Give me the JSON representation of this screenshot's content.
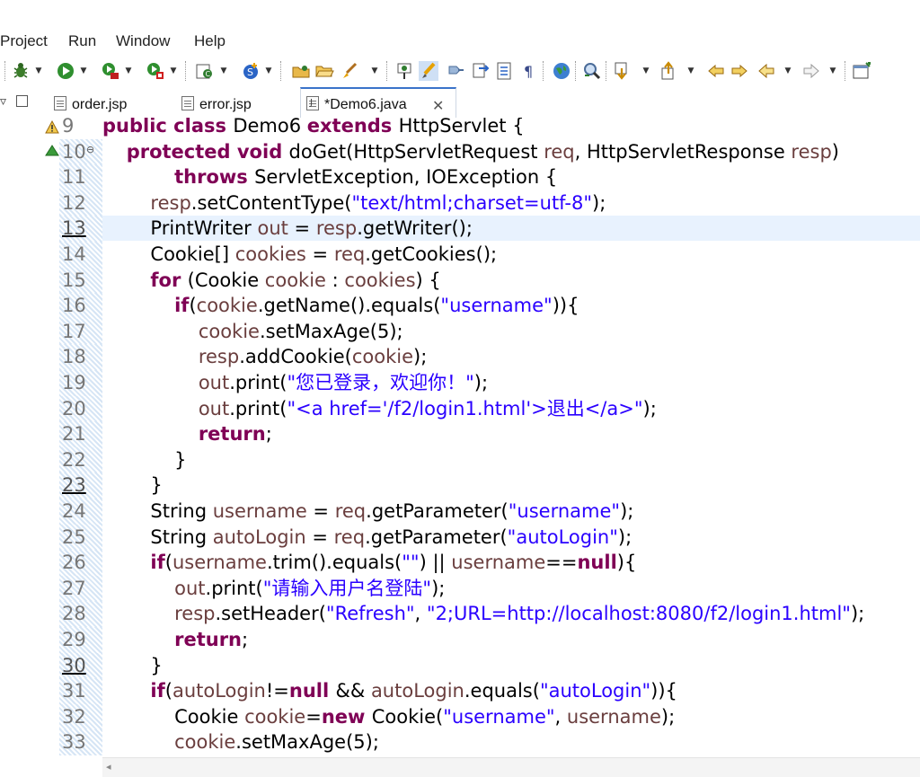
{
  "menu": [
    "Project",
    "Run",
    "Window",
    "Help"
  ],
  "tabs": [
    {
      "label": "order.jsp",
      "active": false
    },
    {
      "label": "error.jsp",
      "active": false
    },
    {
      "label": "*Demo6.java",
      "active": true
    }
  ],
  "toolbar_icons": [
    "bug-debug-icon",
    "run-icon",
    "run-server-icon",
    "external-tools-icon",
    "new-class-icon",
    "new-service-icon",
    "open-type-icon",
    "open-folder-icon",
    "brush-icon",
    "pin-icon",
    "highlighter-icon",
    "marker-icon",
    "bookmark-icon",
    "task-list-icon",
    "show-whitespace-icon",
    "globe-icon",
    "search-icon",
    "next-annotation-icon",
    "prev-annotation-icon",
    "back-icon",
    "forward-icon",
    "previous-edit-icon",
    "next-edit-icon",
    "new-window-icon"
  ],
  "editor": {
    "current_line": "13",
    "lines": [
      {
        "num": "9",
        "marked": false,
        "band": false,
        "segments": [
          {
            "t": "public class ",
            "k": "kw"
          },
          {
            "t": "Demo6 "
          },
          {
            "t": "extends ",
            "k": "kw"
          },
          {
            "t": "HttpServlet {"
          }
        ]
      },
      {
        "num": "10",
        "marked": false,
        "band": true,
        "segments": [
          {
            "t": "    "
          },
          {
            "t": "protected void ",
            "k": "kw"
          },
          {
            "t": "doGet(HttpServletRequest "
          },
          {
            "t": "req",
            "k": "fld"
          },
          {
            "t": ", HttpServletResponse "
          },
          {
            "t": "resp",
            "k": "fld"
          },
          {
            "t": ")"
          }
        ]
      },
      {
        "num": "11",
        "marked": false,
        "band": true,
        "segments": [
          {
            "t": "            "
          },
          {
            "t": "throws ",
            "k": "kw"
          },
          {
            "t": "ServletException, IOException {"
          }
        ]
      },
      {
        "num": "12",
        "marked": false,
        "band": true,
        "segments": [
          {
            "t": "        "
          },
          {
            "t": "resp",
            "k": "fld"
          },
          {
            "t": ".setContentType("
          },
          {
            "t": "\"text/html;charset=utf-8\"",
            "k": "str"
          },
          {
            "t": ");"
          }
        ]
      },
      {
        "num": "13",
        "marked": true,
        "band": true,
        "segments": [
          {
            "t": "        PrintWriter "
          },
          {
            "t": "out",
            "k": "fld"
          },
          {
            "t": " = "
          },
          {
            "t": "resp",
            "k": "fld"
          },
          {
            "t": ".getWriter();"
          }
        ]
      },
      {
        "num": "14",
        "marked": false,
        "band": true,
        "segments": [
          {
            "t": "        Cookie[] "
          },
          {
            "t": "cookies",
            "k": "fld"
          },
          {
            "t": " = "
          },
          {
            "t": "req",
            "k": "fld"
          },
          {
            "t": ".getCookies();"
          }
        ]
      },
      {
        "num": "15",
        "marked": false,
        "band": true,
        "segments": [
          {
            "t": "        "
          },
          {
            "t": "for ",
            "k": "kw"
          },
          {
            "t": "(Cookie "
          },
          {
            "t": "cookie",
            "k": "fld"
          },
          {
            "t": " : "
          },
          {
            "t": "cookies",
            "k": "fld"
          },
          {
            "t": ") {"
          }
        ]
      },
      {
        "num": "16",
        "marked": false,
        "band": true,
        "segments": [
          {
            "t": "            "
          },
          {
            "t": "if",
            "k": "kw"
          },
          {
            "t": "("
          },
          {
            "t": "cookie",
            "k": "fld"
          },
          {
            "t": ".getName().equals("
          },
          {
            "t": "\"username\"",
            "k": "str"
          },
          {
            "t": ")){"
          }
        ]
      },
      {
        "num": "17",
        "marked": false,
        "band": true,
        "segments": [
          {
            "t": "                "
          },
          {
            "t": "cookie",
            "k": "fld"
          },
          {
            "t": ".setMaxAge(5);"
          }
        ]
      },
      {
        "num": "18",
        "marked": false,
        "band": true,
        "segments": [
          {
            "t": "                "
          },
          {
            "t": "resp",
            "k": "fld"
          },
          {
            "t": ".addCookie("
          },
          {
            "t": "cookie",
            "k": "fld"
          },
          {
            "t": ");"
          }
        ]
      },
      {
        "num": "19",
        "marked": false,
        "band": true,
        "segments": [
          {
            "t": "                "
          },
          {
            "t": "out",
            "k": "fld"
          },
          {
            "t": ".print("
          },
          {
            "t": "\"您已登录，欢迎你！\"",
            "k": "str"
          },
          {
            "t": ");"
          }
        ]
      },
      {
        "num": "20",
        "marked": false,
        "band": true,
        "segments": [
          {
            "t": "                "
          },
          {
            "t": "out",
            "k": "fld"
          },
          {
            "t": ".print("
          },
          {
            "t": "\"<a href='/f2/login1.html'>退出</a>\"",
            "k": "str"
          },
          {
            "t": ");"
          }
        ]
      },
      {
        "num": "21",
        "marked": false,
        "band": true,
        "segments": [
          {
            "t": "                "
          },
          {
            "t": "return",
            "k": "kw"
          },
          {
            "t": ";"
          }
        ]
      },
      {
        "num": "22",
        "marked": false,
        "band": true,
        "segments": [
          {
            "t": "            }"
          }
        ]
      },
      {
        "num": "23",
        "marked": true,
        "band": true,
        "segments": [
          {
            "t": "        }"
          }
        ]
      },
      {
        "num": "24",
        "marked": false,
        "band": true,
        "segments": [
          {
            "t": "        String "
          },
          {
            "t": "username",
            "k": "fld"
          },
          {
            "t": " = "
          },
          {
            "t": "req",
            "k": "fld"
          },
          {
            "t": ".getParameter("
          },
          {
            "t": "\"username\"",
            "k": "str"
          },
          {
            "t": ");"
          }
        ]
      },
      {
        "num": "25",
        "marked": false,
        "band": true,
        "segments": [
          {
            "t": "        String "
          },
          {
            "t": "autoLogin",
            "k": "fld"
          },
          {
            "t": " = "
          },
          {
            "t": "req",
            "k": "fld"
          },
          {
            "t": ".getParameter("
          },
          {
            "t": "\"autoLogin\"",
            "k": "str"
          },
          {
            "t": ");"
          }
        ]
      },
      {
        "num": "26",
        "marked": false,
        "band": true,
        "segments": [
          {
            "t": "        "
          },
          {
            "t": "if",
            "k": "kw"
          },
          {
            "t": "("
          },
          {
            "t": "username",
            "k": "fld"
          },
          {
            "t": ".trim().equals("
          },
          {
            "t": "\"\"",
            "k": "str"
          },
          {
            "t": ") || "
          },
          {
            "t": "username",
            "k": "fld"
          },
          {
            "t": "=="
          },
          {
            "t": "null",
            "k": "kw"
          },
          {
            "t": "){"
          }
        ]
      },
      {
        "num": "27",
        "marked": false,
        "band": true,
        "segments": [
          {
            "t": "            "
          },
          {
            "t": "out",
            "k": "fld"
          },
          {
            "t": ".print("
          },
          {
            "t": "\"请输入用户名登陆\"",
            "k": "str"
          },
          {
            "t": ");"
          }
        ]
      },
      {
        "num": "28",
        "marked": false,
        "band": true,
        "segments": [
          {
            "t": "            "
          },
          {
            "t": "resp",
            "k": "fld"
          },
          {
            "t": ".setHeader("
          },
          {
            "t": "\"Refresh\"",
            "k": "str"
          },
          {
            "t": ", "
          },
          {
            "t": "\"2;URL=http://localhost:8080/f2/login1.html\"",
            "k": "str"
          },
          {
            "t": ");"
          }
        ]
      },
      {
        "num": "29",
        "marked": false,
        "band": true,
        "segments": [
          {
            "t": "            "
          },
          {
            "t": "return",
            "k": "kw"
          },
          {
            "t": ";"
          }
        ]
      },
      {
        "num": "30",
        "marked": true,
        "band": true,
        "segments": [
          {
            "t": "        }"
          }
        ]
      },
      {
        "num": "31",
        "marked": false,
        "band": true,
        "segments": [
          {
            "t": "        "
          },
          {
            "t": "if",
            "k": "kw"
          },
          {
            "t": "("
          },
          {
            "t": "autoLogin",
            "k": "fld"
          },
          {
            "t": "!="
          },
          {
            "t": "null ",
            "k": "kw"
          },
          {
            "t": "&& "
          },
          {
            "t": "autoLogin",
            "k": "fld"
          },
          {
            "t": ".equals("
          },
          {
            "t": "\"autoLogin\"",
            "k": "str"
          },
          {
            "t": ")){"
          }
        ]
      },
      {
        "num": "32",
        "marked": false,
        "band": true,
        "segments": [
          {
            "t": "            Cookie "
          },
          {
            "t": "cookie",
            "k": "fld"
          },
          {
            "t": "="
          },
          {
            "t": "new ",
            "k": "kw"
          },
          {
            "t": "Cookie("
          },
          {
            "t": "\"username\"",
            "k": "str"
          },
          {
            "t": ", "
          },
          {
            "t": "username",
            "k": "fld"
          },
          {
            "t": ");"
          }
        ]
      },
      {
        "num": "33",
        "marked": false,
        "band": true,
        "segments": [
          {
            "t": "            "
          },
          {
            "t": "cookie",
            "k": "fld"
          },
          {
            "t": ".setMaxAge(5);"
          }
        ]
      }
    ]
  },
  "colors": {
    "keyword": "#7f0055",
    "string": "#2a00ff",
    "field": "#6a3e3e",
    "current_line": "#e8f2fe",
    "tab_accent": "#3a73c9"
  }
}
